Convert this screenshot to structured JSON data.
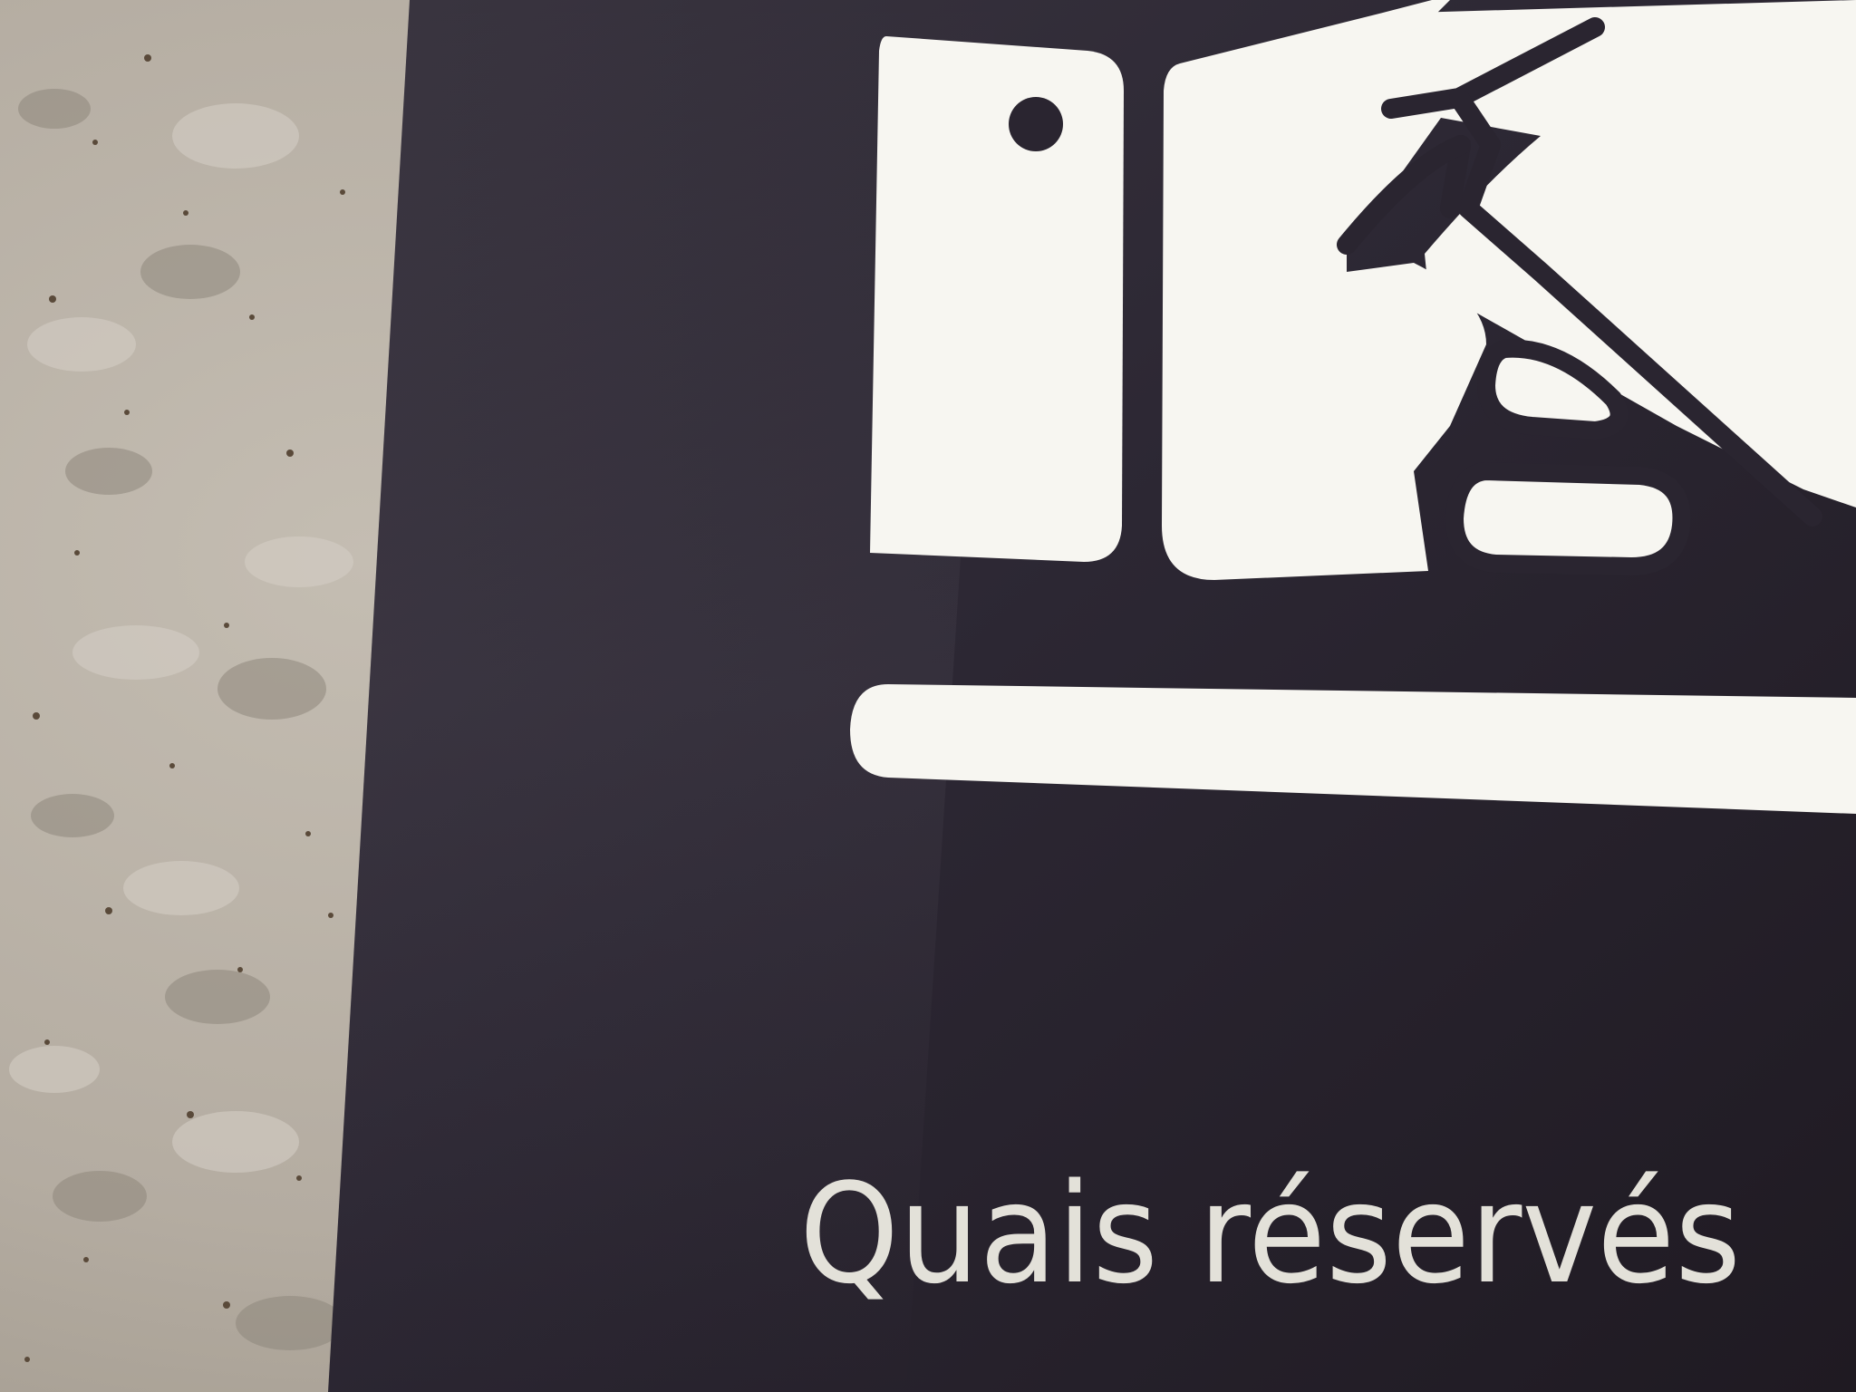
{
  "sign": {
    "text": "Quais réservés",
    "pictogram": "ticket-and-hand-icon",
    "underline": "white-bar",
    "panel_color": "#2a2530",
    "symbol_color": "#f7f6f1",
    "text_color": "#e3e1d9",
    "wall_color": "#b7afa4"
  }
}
